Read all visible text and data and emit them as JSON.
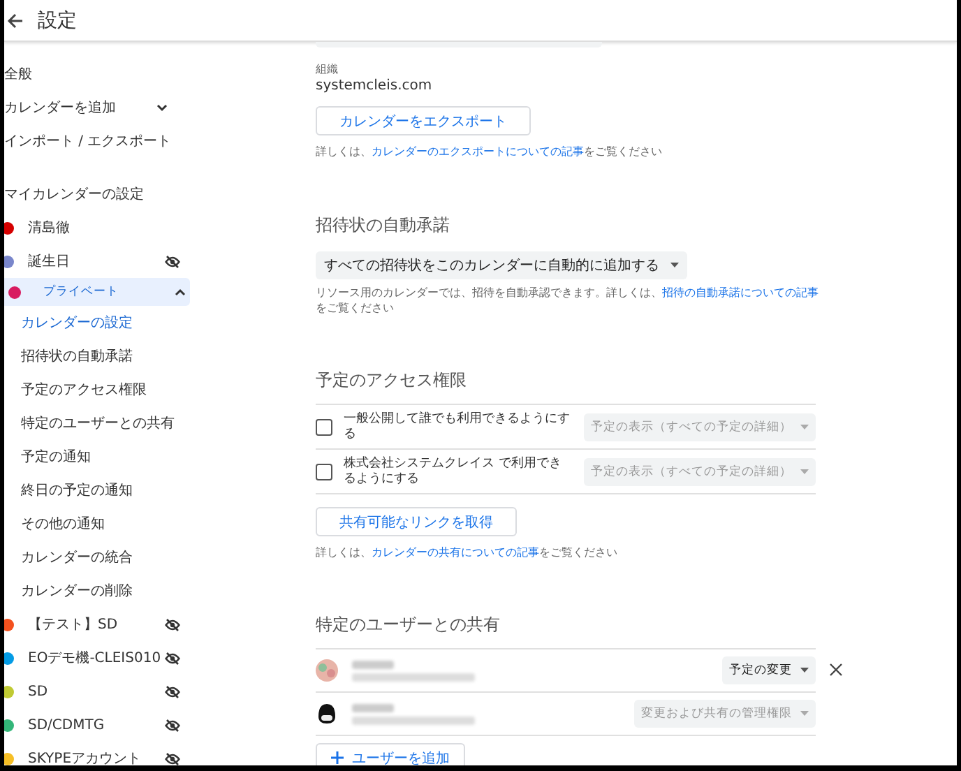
{
  "header": {
    "title": "設定"
  },
  "sidebar": {
    "top_items": [
      {
        "label": "全般",
        "kind": "plain"
      },
      {
        "label": "カレンダーを追加",
        "kind": "dropdown",
        "expanded": false
      },
      {
        "label": "インポート / エクスポート",
        "kind": "plain"
      }
    ],
    "section_title": "マイカレンダーの設定",
    "calendars": [
      {
        "name": "清島徹",
        "color": "#d50000",
        "hidden": false,
        "selected": false
      },
      {
        "name": "誕生日",
        "color": "#7986cb",
        "hidden": true,
        "selected": false
      },
      {
        "name": "プライベート",
        "color": "#d81b60",
        "hidden": false,
        "selected": true,
        "children": [
          {
            "label": "カレンダーの設定",
            "selected": true
          },
          {
            "label": "招待状の自動承諾",
            "selected": false
          },
          {
            "label": "予定のアクセス権限",
            "selected": false
          },
          {
            "label": "特定のユーザーとの共有",
            "selected": false
          },
          {
            "label": "予定の通知",
            "selected": false
          },
          {
            "label": "終日の予定の通知",
            "selected": false
          },
          {
            "label": "その他の通知",
            "selected": false
          },
          {
            "label": "カレンダーの統合",
            "selected": false
          },
          {
            "label": "カレンダーの削除",
            "selected": false
          }
        ]
      },
      {
        "name": "【テスト】SD",
        "color": "#f4511e",
        "hidden": true,
        "selected": false
      },
      {
        "name": "EOデモ機-CLEIS010",
        "color": "#039be5",
        "hidden": true,
        "selected": false
      },
      {
        "name": "SD",
        "color": "#c0ca33",
        "hidden": true,
        "selected": false
      },
      {
        "name": "SD/CDMTG",
        "color": "#33b679",
        "hidden": true,
        "selected": false
      },
      {
        "name": "SKYPEアカウント",
        "color": "#f6bf26",
        "hidden": true,
        "selected": false
      }
    ]
  },
  "organization": {
    "label": "組織",
    "value": "systemcleis.com"
  },
  "export": {
    "button": "カレンダーをエクスポート",
    "help": {
      "before": "詳しくは、",
      "link": "カレンダーのエクスポートについての記事",
      "after": "をご覧ください"
    }
  },
  "auto_accept": {
    "title": "招待状の自動承諾",
    "dropdown": "すべての招待状をこのカレンダーに自動的に追加する",
    "note": {
      "before": "リソース用のカレンダーでは、招待を自動承認できます。詳しくは、",
      "link": "招待の自動承諾についての記事",
      "after": "をご覧ください"
    }
  },
  "access": {
    "title": "予定のアクセス権限",
    "rows": [
      {
        "label": "一般公開して誰でも利用できるようにする",
        "checked": false,
        "dropdown": "予定の表示（すべての予定の詳細）",
        "disabled": true
      },
      {
        "label": "株式会社システムクレイス で利用できるようにする",
        "checked": false,
        "dropdown": "予定の表示（すべての予定の詳細）",
        "disabled": true
      }
    ],
    "button": "共有可能なリンクを取得",
    "help": {
      "before": "詳しくは、",
      "link": "カレンダーの共有についての記事",
      "after": "をご覧ください"
    }
  },
  "sharing": {
    "title": "特定のユーザーとの共有",
    "users": [
      {
        "permission": "予定の変更",
        "disabled": false,
        "removable": true
      },
      {
        "permission": "変更および共有の管理権限",
        "disabled": true,
        "removable": false
      }
    ],
    "add_button": "ユーザーを追加"
  }
}
